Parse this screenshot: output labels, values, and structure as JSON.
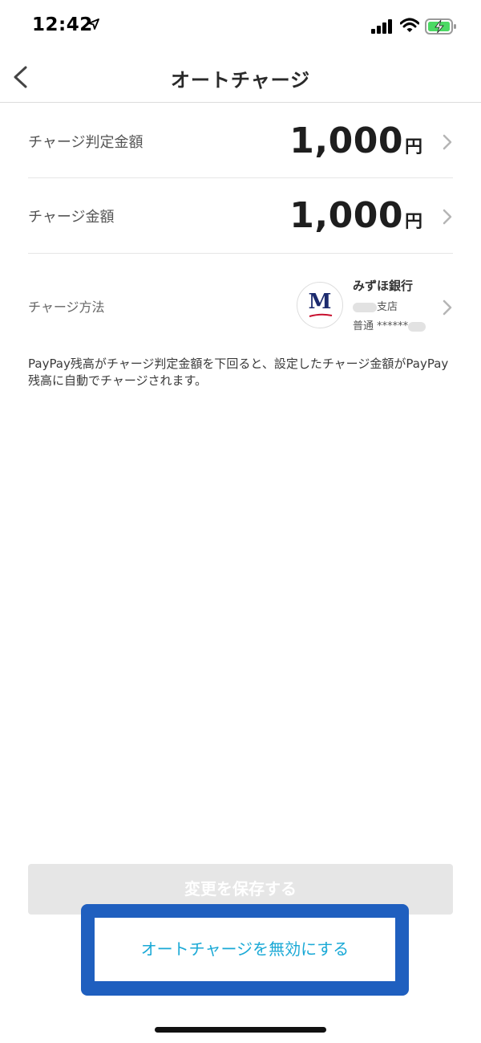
{
  "status_bar": {
    "time": "12:42"
  },
  "nav": {
    "title": "オートチャージ"
  },
  "rows": [
    {
      "label": "チャージ判定金額",
      "amount": "1,000",
      "unit": "円"
    },
    {
      "label": "チャージ金額",
      "amount": "1,000",
      "unit": "円"
    }
  ],
  "charge_method": {
    "label": "チャージ方法",
    "bank_name": "みずほ銀行",
    "branch_suffix": "支店",
    "account_type": "普通",
    "account_masked": "******",
    "logo_letter": "M"
  },
  "description": "PayPay残高がチャージ判定金額を下回ると、設定したチャージ金額がPayPay残高に自動でチャージされます。",
  "buttons": {
    "save": "変更を保存する",
    "disable": "オートチャージを無効にする"
  },
  "colors": {
    "link_cyan": "#1aa9d6",
    "highlight_blue": "#1f5fbf",
    "disabled_gray": "#e6e6e6",
    "bank_navy": "#1c2b6e",
    "bank_red": "#c8102e",
    "battery_green": "#4cd964"
  }
}
